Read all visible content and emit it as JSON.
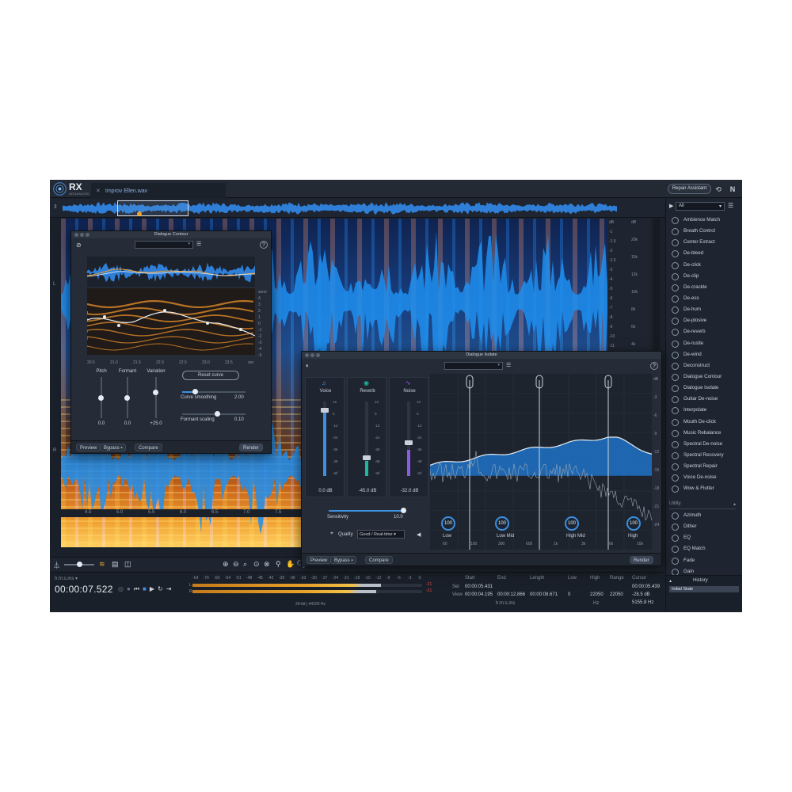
{
  "app": {
    "logo_text": "RX",
    "logo_sub": "ADVANCED",
    "file_tab": "Improv Ellen.wav",
    "repair_assistant": "Repair Assistant",
    "left_channel": "L",
    "right_channel": "R"
  },
  "ruler": {
    "db_labels": [
      "dB",
      "-1",
      "-1.5",
      "-2",
      "-2.5",
      "-3",
      "-4",
      "-5",
      "-6",
      "-7",
      "-8",
      "-9",
      "-10",
      "-11",
      "-13",
      "-15",
      "-17",
      "-20"
    ],
    "hz_labels": [
      "dB",
      "20k",
      "15k",
      "12k",
      "10k",
      "8k",
      "6k",
      "4k",
      "2k"
    ],
    "timeline": [
      "4.5",
      "5.0",
      "5.5",
      "6.0",
      "6.5",
      "7.0",
      "7.5",
      "8.0",
      "8.5",
      "9.0"
    ]
  },
  "dialogue_contour": {
    "title": "Dialogue Contour",
    "pitch": "Pitch",
    "formant": "Formant",
    "variation": "Variation",
    "pitch_val": "0.0",
    "formant_val": "0.0",
    "variation_val": "+25.0",
    "reset": "Reset curve",
    "curve_smoothing": "Curve smoothing",
    "curve_smoothing_val": "2.00",
    "formant_scaling": "Formant scaling",
    "formant_scaling_val": "0.10",
    "x_labels": [
      "20.5",
      "21.0",
      "21.5",
      "22.0",
      "22.5",
      "23.0",
      "23.5",
      "sec"
    ],
    "y_labels": [
      "semi",
      "4",
      "3",
      "2",
      "1",
      "0",
      "-1",
      "-2",
      "-3",
      "-4",
      "-5"
    ],
    "preview": "Preview",
    "bypass": "Bypass",
    "compare": "Compare",
    "render": "Render"
  },
  "dialogue_isolate": {
    "title": "Dialogue Isolate",
    "voice": "Voice",
    "reverb": "Reverb",
    "noise": "Noise",
    "voice_val": "0.0 dB",
    "reverb_val": "-45.0 dB",
    "noise_val": "-32.0 dB",
    "fader_scale": [
      "12",
      "0",
      "-12",
      "-24",
      "-36",
      "-48",
      "-Inf"
    ],
    "sensitivity": "Sensitivity",
    "sensitivity_val": "10.0",
    "quality": "Quality",
    "quality_val": "Good / Real-time",
    "bands": [
      {
        "label": "Low",
        "value": "100"
      },
      {
        "label": "Low Mid",
        "value": "100"
      },
      {
        "label": "High Mid",
        "value": "100"
      },
      {
        "label": "High",
        "value": "100"
      }
    ],
    "freq_labels": [
      "60",
      "100",
      "300",
      "600",
      "1k",
      "3k",
      "6k",
      "10k"
    ],
    "db_labels": [
      "dB",
      "-3",
      "-6",
      "-9",
      "-12",
      "-15",
      "-18",
      "-21",
      "-24"
    ],
    "preview": "Preview",
    "bypass": "Bypass",
    "compare": "Compare",
    "render": "Render"
  },
  "modules": {
    "filter": "All",
    "items": [
      "Ambience Match",
      "Breath Control",
      "Center Extract",
      "De-bleed",
      "De-click",
      "De-clip",
      "De-crackle",
      "De-ess",
      "De-hum",
      "De-plosive",
      "De-reverb",
      "De-rustle",
      "De-wind",
      "Deconstruct",
      "Dialogue Contour",
      "Dialogue Isolate",
      "Guitar De-noise",
      "Interpolate",
      "Mouth De-click",
      "Music Rebalance",
      "Spectral De-noise",
      "Spectral Recovery",
      "Spectral Repair",
      "Voice De-noise",
      "Wow & Flutter"
    ],
    "utility_header": "Utility",
    "utility_items": [
      "Azimuth",
      "Dither",
      "EQ",
      "EQ Match",
      "Fade",
      "Gain"
    ]
  },
  "history": {
    "title": "History",
    "item": "Initial State"
  },
  "bottom": {
    "tc_format": "h:m:s.ms",
    "timecode": "00:00:07.522",
    "meter_scale": [
      "-Inf",
      "-70",
      "-60",
      "-54",
      "-51",
      "-48",
      "-45",
      "-42",
      "-39",
      "-36",
      "-33",
      "-30",
      "-27",
      "-24",
      "-21",
      "-18",
      "-15",
      "-12",
      "-9",
      "-6",
      "-3",
      "0"
    ],
    "meter_l": "L",
    "meter_r": "R",
    "meter_l_val": "-21",
    "meter_r_val": "-21",
    "meter_l_fill": 0.82,
    "meter_r_fill": 0.8,
    "format": "24-bit | 44100 Hz",
    "sel_label": "Sel",
    "view_label": "View",
    "start_h": "Start",
    "end_h": "End",
    "length_h": "Length",
    "sel_start": "00:00:05.431",
    "view_start": "00:00:04.195",
    "view_end": "00:00:12.866",
    "view_length": "00:00:08.671",
    "unit_hms": "h:m:s.ms",
    "low_h": "Low",
    "high_h": "High",
    "range_h": "Range",
    "cursor_h": "Cursor",
    "view_low": "0",
    "view_high": "22050",
    "view_range": "22050",
    "unit_hz": "Hz",
    "cursor_time": "00:00:05.439",
    "cursor_db": "-28.5 dB",
    "cursor_hz": "5155.8 Hz"
  }
}
